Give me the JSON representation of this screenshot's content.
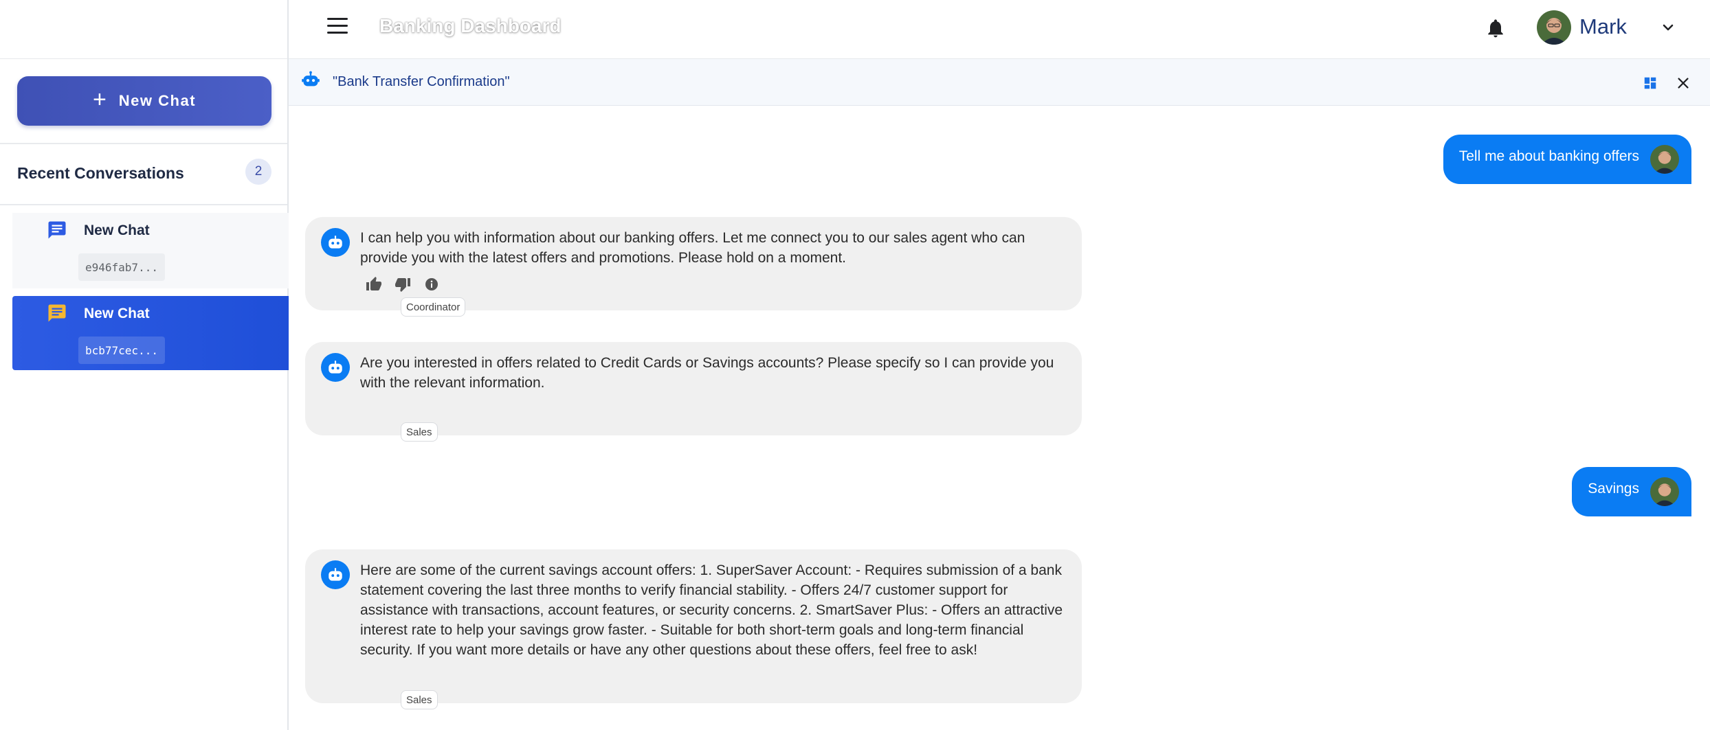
{
  "header": {
    "app_title": "Banking Dashboard",
    "user_name": "Mark"
  },
  "sidebar": {
    "new_chat_label": "New Chat",
    "recent_title": "Recent Conversations",
    "recent_count": "2",
    "conversations": [
      {
        "title": "New Chat",
        "id": "e946fab7...",
        "active": false
      },
      {
        "title": "New Chat",
        "id": "bcb77cec...",
        "active": true
      }
    ]
  },
  "chat": {
    "title": "\"Bank Transfer Confirmation\"",
    "messages": [
      {
        "role": "user",
        "text": "Tell me about banking offers"
      },
      {
        "role": "bot",
        "text": "I can help you with information about our banking offers. Let me connect you to our sales agent who can provide you with the latest offers and promotions. Please hold on a moment.",
        "agent": "Coordinator"
      },
      {
        "role": "bot",
        "text": "Are you interested in offers related to Credit Cards or Savings accounts? Please specify so I can provide you with the relevant information.",
        "agent": "Sales"
      },
      {
        "role": "user",
        "text": "Savings"
      },
      {
        "role": "bot",
        "text": "Here are some of the current savings account offers: 1. SuperSaver Account: - Requires submission of a bank statement covering the last three months to verify financial stability. - Offers 24/7 customer support for assistance with transactions, account features, or security concerns. 2. SmartSaver Plus: - Offers an attractive interest rate to help your savings grow faster. - Suitable for both short-term goals and long-term financial security. If you want more details or have any other questions about these offers, feel free to ask!",
        "agent": "Sales"
      }
    ]
  },
  "colors": {
    "accent": "#0a7cf3",
    "new_chat_button": "#3f51b5",
    "active_conversation": "#2d5be3",
    "bot_bubble": "#f0f0f0"
  },
  "icons": [
    "menu-icon",
    "bell-icon",
    "chevron-down-icon",
    "plus-icon",
    "chat-bubble-icon",
    "bot-icon",
    "grid-icon",
    "close-icon",
    "thumbs-up-icon",
    "thumbs-down-icon",
    "info-icon"
  ]
}
